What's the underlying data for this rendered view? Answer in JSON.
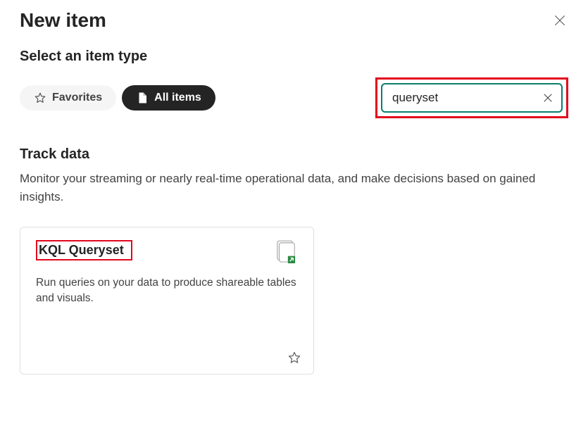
{
  "dialog": {
    "title": "New item",
    "subtitle": "Select an item type"
  },
  "filters": {
    "favorites_label": "Favorites",
    "allitems_label": "All items"
  },
  "search": {
    "value": "queryset",
    "placeholder": ""
  },
  "section": {
    "heading": "Track data",
    "description": "Monitor your streaming or nearly real-time operational data, and make decisions based on gained insights."
  },
  "card": {
    "title": "KQL Queryset",
    "description": "Run queries on your data to produce shareable tables and visuals."
  }
}
